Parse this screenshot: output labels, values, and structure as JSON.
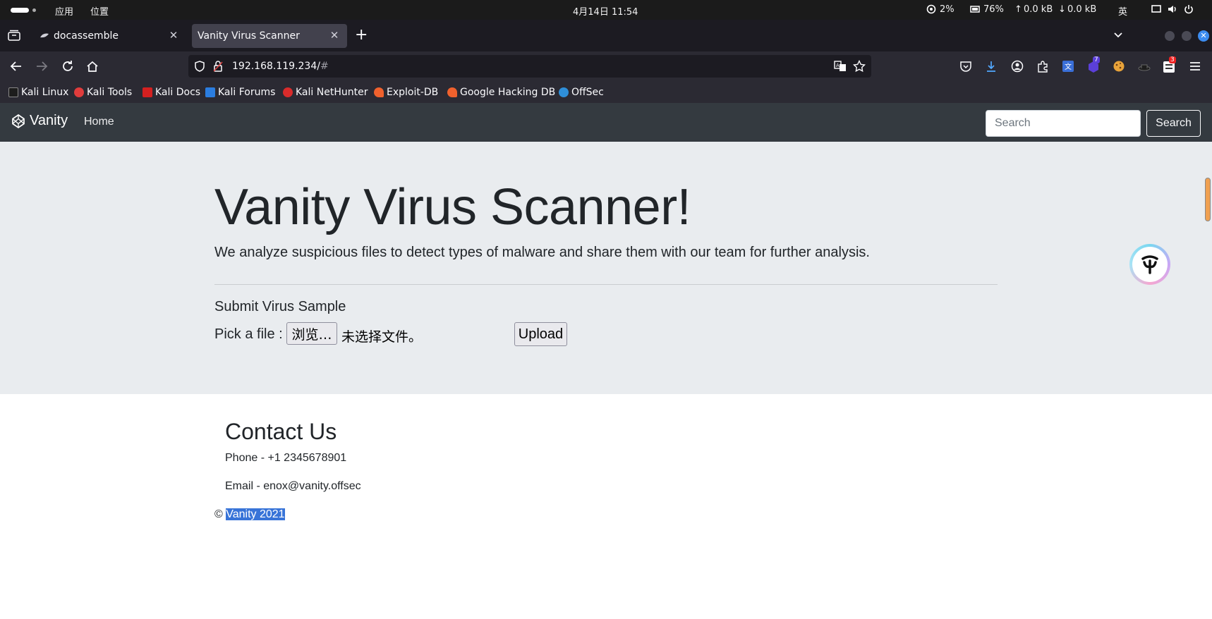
{
  "os": {
    "apps_label": "应用",
    "places_label": "位置",
    "datetime": "4月14日 11:54",
    "cpu": "2%",
    "memory": "76%",
    "net_up": "0.0 kB",
    "net_down": "0.0 kB",
    "input_method": "英"
  },
  "browser": {
    "tabs": [
      {
        "label": "docassemble",
        "active": false
      },
      {
        "label": "Vanity Virus Scanner",
        "active": true
      }
    ],
    "url_host": "192.168.119.234/",
    "url_hash": "#",
    "bookmarks": [
      {
        "label": "Kali Linux",
        "icon": "kali-icon",
        "color": "#1d1d1d"
      },
      {
        "label": "Kali Tools",
        "icon": "kali-tools-icon",
        "color": "#e03c3c"
      },
      {
        "label": "Kali Docs",
        "icon": "kali-docs-icon",
        "color": "#d42020"
      },
      {
        "label": "Kali Forums",
        "icon": "kali-forums-icon",
        "color": "#2b7de0"
      },
      {
        "label": "Kali NetHunter",
        "icon": "nethunter-icon",
        "color": "#d92b2b"
      },
      {
        "label": "Exploit-DB",
        "icon": "exploitdb-icon",
        "color": "#f0612d"
      },
      {
        "label": "Google Hacking DB",
        "icon": "ghdb-icon",
        "color": "#f0612d"
      },
      {
        "label": "OffSec",
        "icon": "offsec-icon",
        "color": "#2f8fd9"
      }
    ],
    "badge_extension": "7",
    "badge_extension2": "3"
  },
  "site": {
    "brand": "Vanity",
    "nav_home": "Home",
    "search_placeholder": "Search",
    "search_button": "Search",
    "hero_title": "Vanity Virus Scanner!",
    "hero_lead": "We analyze suspicious files to detect types of malware and share them with our team for further analysis.",
    "submit_title": "Submit Virus Sample",
    "pick_label": "Pick a file :",
    "browse_label": "浏览…",
    "no_file_label": "未选择文件。",
    "upload_label": "Upload",
    "contact_title": "Contact Us",
    "phone": "Phone - +1 2345678901",
    "email": "Email - enox@vanity.offsec",
    "copyright_symbol": "©",
    "copyright_text": "Vanity 2021"
  },
  "colors": {
    "navbar": "#343a40",
    "jumbotron": "#e9ecef",
    "selection": "#3874d8"
  }
}
